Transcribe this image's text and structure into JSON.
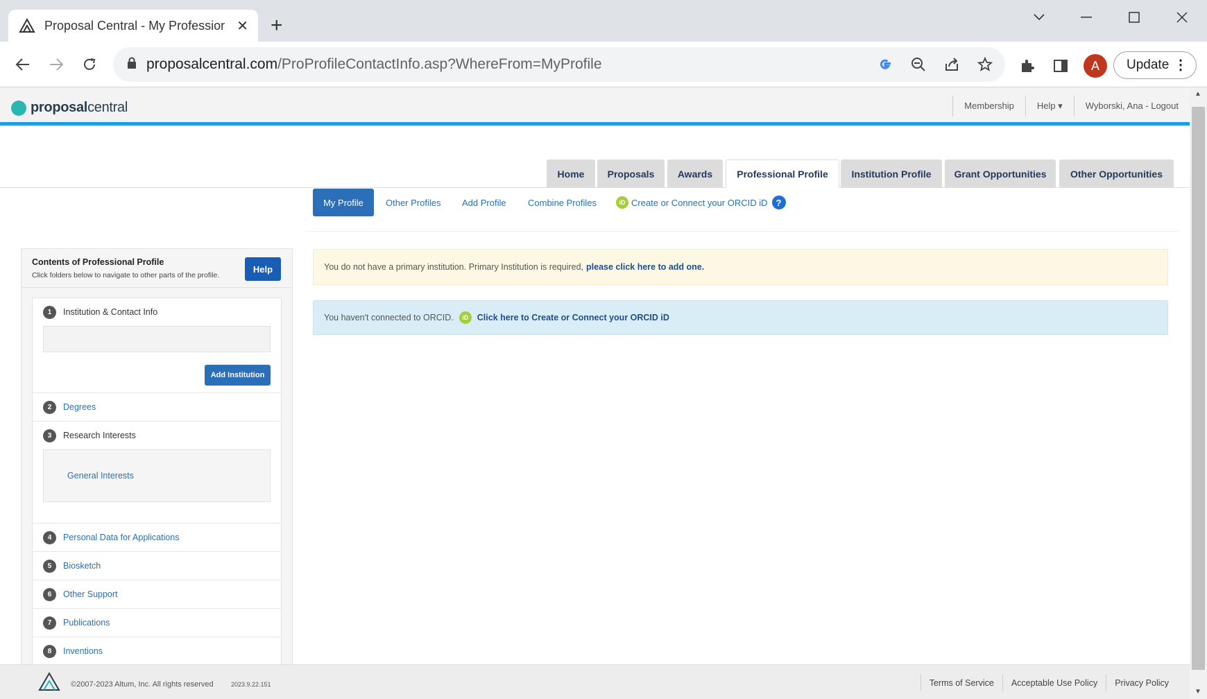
{
  "browser": {
    "tab_title": "Proposal Central - My Profession",
    "url_host": "proposalcentral.com",
    "url_path": "/ProProfileContactInfo.asp?WhereFrom=MyProfile",
    "avatar_letter": "A",
    "update_label": "Update"
  },
  "header": {
    "logo_bold": "proposal",
    "logo_light": "central",
    "links": [
      "Membership",
      "Help ▾",
      "Wyborski, Ana - Logout"
    ]
  },
  "main_tabs": [
    "Home",
    "Proposals",
    "Awards",
    "Professional Profile",
    "Institution Profile",
    "Grant Opportunities",
    "Other Opportunities"
  ],
  "sub_tabs": {
    "my_profile": "My Profile",
    "other_profiles": "Other Profiles",
    "add_profile": "Add Profile",
    "combine_profiles": "Combine Profiles",
    "orcid": "Create or Connect your ORCID iD"
  },
  "left_panel": {
    "title": "Contents of Professional Profile",
    "subtitle": "Click folders below to navigate to other parts of the profile.",
    "help_label": "Help",
    "items": [
      {
        "num": "1",
        "label": "Institution & Contact Info"
      },
      {
        "num": "2",
        "label": "Degrees"
      },
      {
        "num": "3",
        "label": "Research Interests"
      },
      {
        "num": "4",
        "label": "Personal Data for Applications"
      },
      {
        "num": "5",
        "label": "Biosketch"
      },
      {
        "num": "6",
        "label": "Other Support"
      },
      {
        "num": "7",
        "label": "Publications"
      },
      {
        "num": "8",
        "label": "Inventions"
      }
    ],
    "add_institution_label": "Add Institution",
    "general_interests_label": "General Interests"
  },
  "alerts": {
    "warning_text": "You do not have a primary institution. Primary Institution is required,",
    "warning_link": "please click here to add one.",
    "info_text": "You haven't connected to ORCID.",
    "info_link": "Click here to Create or Connect your ORCID iD"
  },
  "footer": {
    "copyright": "©2007-2023 Altum, Inc. All rights reserved",
    "version": "2023.9.22.151",
    "links": [
      "Terms of Service",
      "Acceptable Use Policy",
      "Privacy Policy"
    ]
  },
  "colors": {
    "brand_teal": "#2ab7b3",
    "header_rule": "#1d9ee0",
    "primary_button": "#2a6fb8",
    "link": "#2a6fb0"
  }
}
